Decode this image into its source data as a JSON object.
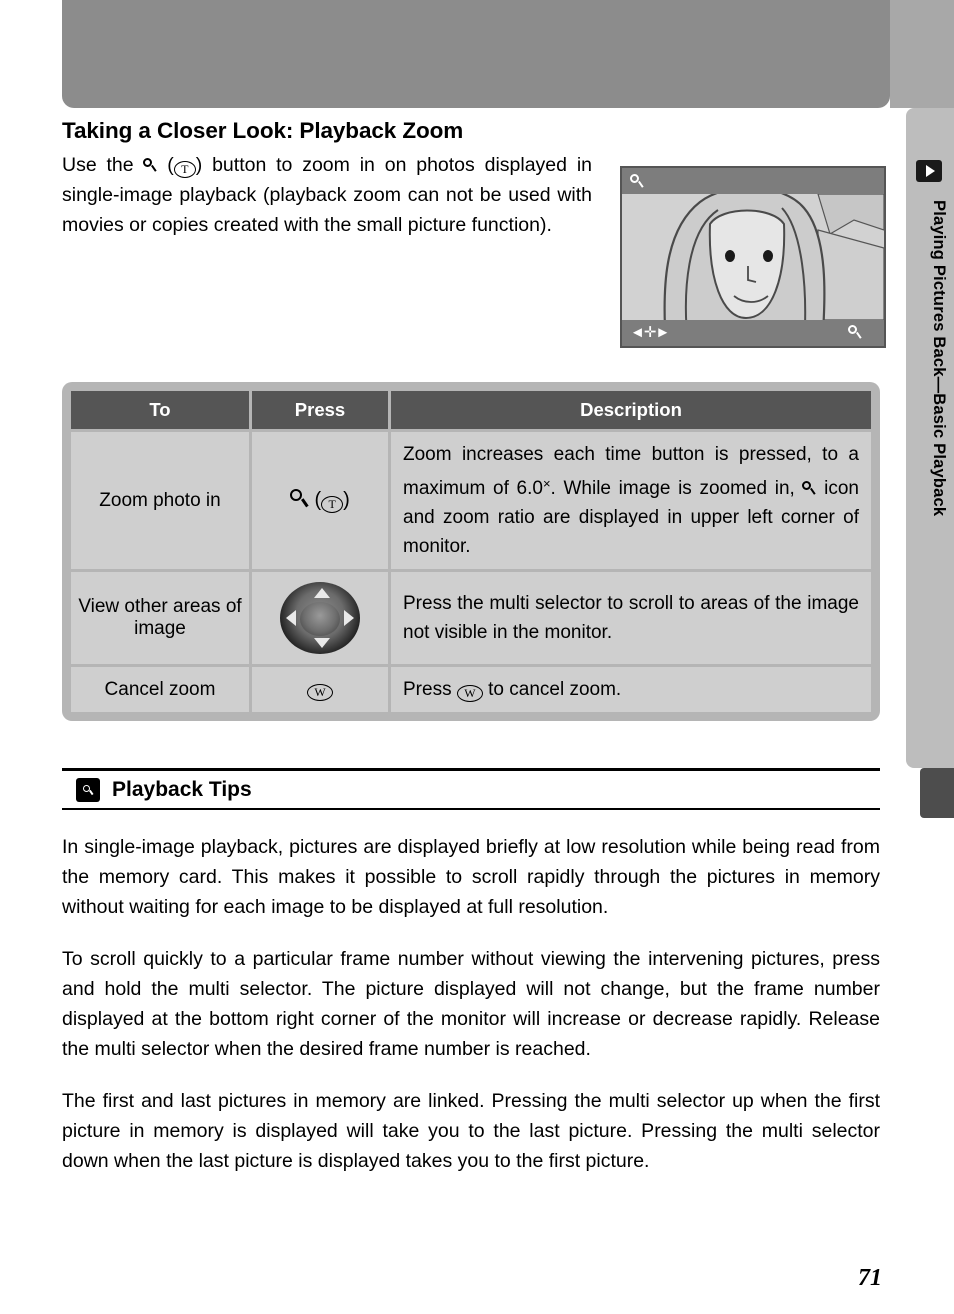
{
  "page": {
    "number": "71",
    "side_tab_label": "Playing Pictures Back—Basic Playback"
  },
  "section": {
    "title": "Taking a Closer Look: Playback Zoom",
    "intro_part1": "Use the ",
    "intro_part2": " (",
    "intro_part3": ") button to zoom in on photos displayed in single-image playback (playback zoom can not be used with movies or copies created with the small picture function).",
    "tele_button_label": "T",
    "wide_button_label": "W"
  },
  "table": {
    "headers": [
      "To",
      "Press",
      "Description"
    ],
    "rows": [
      {
        "to": "Zoom photo in",
        "press_type": "magnifier-tele",
        "description_1": "Zoom increases each time button is pressed, to a maximum of 6.0",
        "description_2": ".  While image is zoomed in, ",
        "description_3": " icon and zoom ratio are displayed in upper left corner of monitor."
      },
      {
        "to": "View other areas of image",
        "press_type": "multi-selector",
        "description_1": "Press the multi selector to scroll to areas of the image not visible in the monitor."
      },
      {
        "to": "Cancel zoom",
        "press_type": "wide-button",
        "description_1": "Press ",
        "description_2": " to cancel zoom."
      }
    ]
  },
  "tips": {
    "title": "Playback Tips",
    "paragraphs": [
      "In single-image playback, pictures are displayed briefly at low resolution while being read from the memory card.  This makes it possible to scroll rapidly through the pictures in memory without waiting for each image to be displayed at full resolution.",
      "To scroll quickly to a particular frame number without viewing the intervening pictures, press and hold the multi selector.  The picture displayed will not change, but the frame number displayed at the bottom right corner of the monitor will increase or decrease rapidly.  Release the multi selector when the desired frame number is reached.",
      "The first and last pictures in memory are linked.  Pressing the multi selector up when the first picture in memory is displayed will take you to the last picture.  Pressing the multi selector down when the last picture is displayed takes you to the first picture."
    ]
  },
  "monitor": {
    "zoom_icon": "magnifier-icon",
    "scroll_icon": "four-way-arrows-icon"
  }
}
